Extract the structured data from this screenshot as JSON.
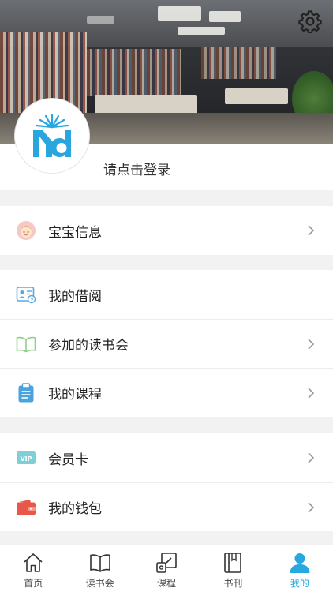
{
  "header": {
    "settings_icon": "gear-icon",
    "login_prompt": "请点击登录"
  },
  "menu": {
    "group1": [
      {
        "label": "宝宝信息",
        "icon": "baby-face-icon",
        "chevron": true
      }
    ],
    "group2": [
      {
        "label": "我的借阅",
        "icon": "id-card-icon",
        "chevron": false
      },
      {
        "label": "参加的读书会",
        "icon": "open-book-icon",
        "chevron": true
      },
      {
        "label": "我的课程",
        "icon": "clipboard-icon",
        "chevron": true
      }
    ],
    "group3": [
      {
        "label": "会员卡",
        "icon": "vip-card-icon",
        "chevron": true
      },
      {
        "label": "我的钱包",
        "icon": "wallet-icon",
        "chevron": true
      }
    ]
  },
  "tabbar": {
    "items": [
      {
        "label": "首页",
        "icon": "home-icon"
      },
      {
        "label": "读书会",
        "icon": "book-icon"
      },
      {
        "label": "课程",
        "icon": "course-icon"
      },
      {
        "label": "书刊",
        "icon": "magazine-icon"
      },
      {
        "label": "我的",
        "icon": "person-icon"
      }
    ],
    "active_index": 4
  },
  "colors": {
    "accent": "#28a8e0",
    "logo_blue": "#2aa6df",
    "wallet_red": "#e8584a",
    "vip_teal": "#7ecfd6",
    "book_green": "#8fcf8a"
  }
}
